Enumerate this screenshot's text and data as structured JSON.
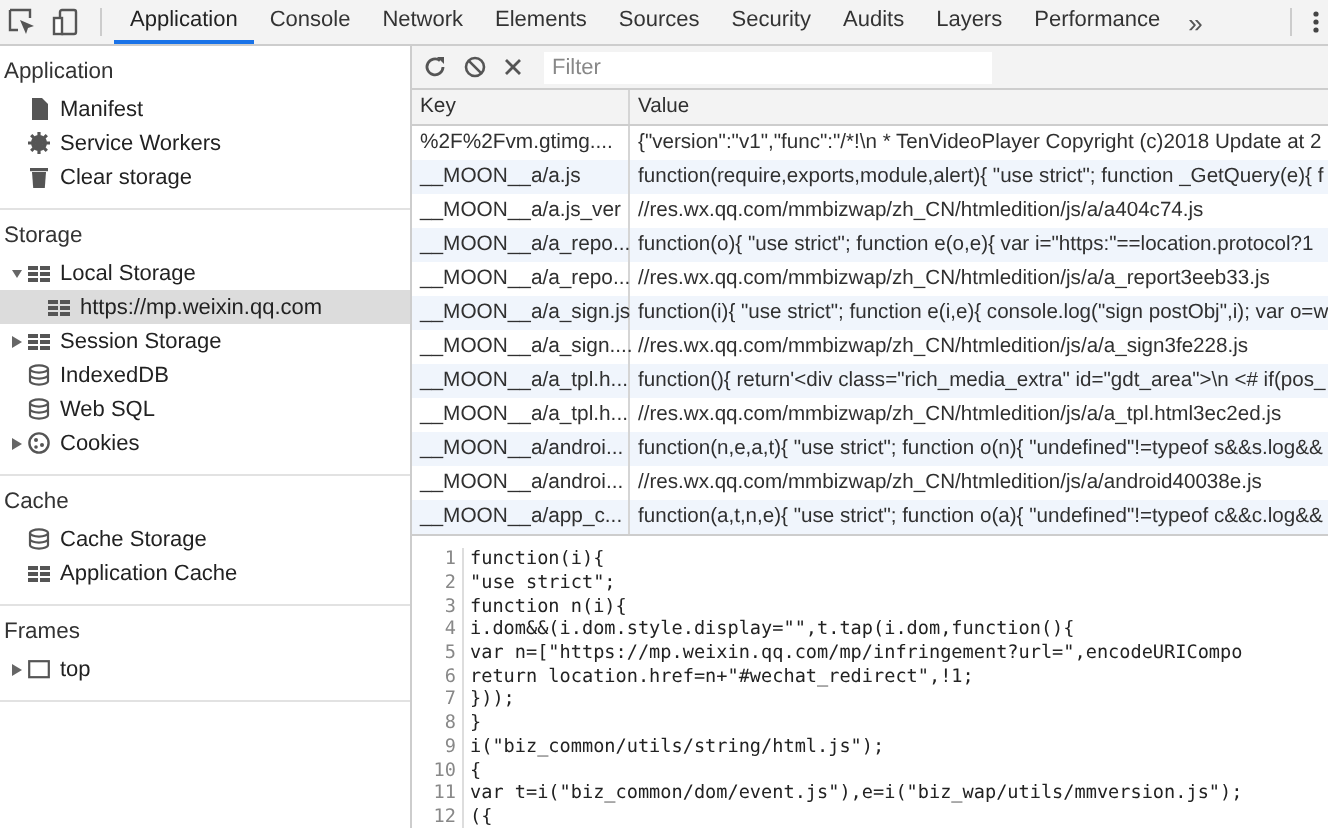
{
  "tabs": [
    {
      "label": "Application",
      "selected": true
    },
    {
      "label": "Console",
      "selected": false
    },
    {
      "label": "Network",
      "selected": false
    },
    {
      "label": "Elements",
      "selected": false
    },
    {
      "label": "Sources",
      "selected": false
    },
    {
      "label": "Security",
      "selected": false
    },
    {
      "label": "Audits",
      "selected": false
    },
    {
      "label": "Layers",
      "selected": false
    },
    {
      "label": "Performance",
      "selected": false
    }
  ],
  "tabs_overflow": "»",
  "sidebar": {
    "sections": [
      {
        "title": "Application",
        "items": [
          {
            "label": "Manifest",
            "kind": "file",
            "selected": false
          },
          {
            "label": "Service Workers",
            "kind": "gear",
            "selected": false
          },
          {
            "label": "Clear storage",
            "kind": "trash",
            "selected": false
          }
        ]
      },
      {
        "title": "Storage",
        "items": [
          {
            "label": "Local Storage",
            "kind": "grid",
            "selected": false,
            "expanded": true,
            "children": [
              {
                "label": "https://mp.weixin.qq.com",
                "kind": "grid",
                "selected": true
              }
            ]
          },
          {
            "label": "Session Storage",
            "kind": "grid",
            "selected": false,
            "expanded": false
          },
          {
            "label": "IndexedDB",
            "kind": "database",
            "selected": false
          },
          {
            "label": "Web SQL",
            "kind": "database",
            "selected": false
          },
          {
            "label": "Cookies",
            "kind": "cookie",
            "selected": false,
            "expanded": false
          }
        ]
      },
      {
        "title": "Cache",
        "items": [
          {
            "label": "Cache Storage",
            "kind": "database",
            "selected": false
          },
          {
            "label": "Application Cache",
            "kind": "grid",
            "selected": false
          }
        ]
      },
      {
        "title": "Frames",
        "items": [
          {
            "label": "top",
            "kind": "frame",
            "selected": false,
            "expanded": false
          }
        ]
      }
    ]
  },
  "filter": {
    "placeholder": "Filter"
  },
  "table": {
    "columns": [
      "Key",
      "Value"
    ],
    "rows": [
      {
        "key": "%2F%2Fvm.gtimg....",
        "value": "{\"version\":\"v1\",\"func\":\"/*!\\n * TenVideoPlayer Copyright (c)2018 Update at 2"
      },
      {
        "key": "__MOON__a/a.js",
        "value": "function(require,exports,module,alert){ \"use strict\"; function _GetQuery(e){ f"
      },
      {
        "key": "__MOON__a/a.js_ver",
        "value": "//res.wx.qq.com/mmbizwap/zh_CN/htmledition/js/a/a404c74.js"
      },
      {
        "key": "__MOON__a/a_repo...",
        "value": "function(o){ \"use strict\"; function e(o,e){ var i=\"https:\"==location.protocol?1"
      },
      {
        "key": "__MOON__a/a_repo...",
        "value": "//res.wx.qq.com/mmbizwap/zh_CN/htmledition/js/a/a_report3eeb33.js"
      },
      {
        "key": "__MOON__a/a_sign.js",
        "value": "function(i){ \"use strict\"; function e(i,e){ console.log(\"sign postObj\",i); var o=w"
      },
      {
        "key": "__MOON__a/a_sign....",
        "value": "//res.wx.qq.com/mmbizwap/zh_CN/htmledition/js/a/a_sign3fe228.js"
      },
      {
        "key": "__MOON__a/a_tpl.h...",
        "value": "function(){ return'<div class=\"rich_media_extra\" id=\"gdt_area\">\\n <# if(pos_"
      },
      {
        "key": "__MOON__a/a_tpl.h...",
        "value": "//res.wx.qq.com/mmbizwap/zh_CN/htmledition/js/a/a_tpl.html3ec2ed.js"
      },
      {
        "key": "__MOON__a/androi...",
        "value": "function(n,e,a,t){ \"use strict\"; function o(n){ \"undefined\"!=typeof s&&s.log&&"
      },
      {
        "key": "__MOON__a/androi...",
        "value": "//res.wx.qq.com/mmbizwap/zh_CN/htmledition/js/a/android40038e.js"
      },
      {
        "key": "__MOON__a/app_c...",
        "value": "function(a,t,n,e){ \"use strict\"; function o(a){ \"undefined\"!=typeof c&&c.log&&"
      }
    ]
  },
  "code": [
    {
      "number": "1",
      "text": "function(i){"
    },
    {
      "number": "2",
      "text": "\"use strict\";"
    },
    {
      "number": "3",
      "text": "function n(i){"
    },
    {
      "number": "4",
      "text": "i.dom&&(i.dom.style.display=\"\",t.tap(i.dom,function(){"
    },
    {
      "number": "5",
      "text": "var n=[\"https://mp.weixin.qq.com/mp/infringement?url=\",encodeURICompo"
    },
    {
      "number": "6",
      "text": "return location.href=n+\"#wechat_redirect\",!1;"
    },
    {
      "number": "7",
      "text": "}));"
    },
    {
      "number": "8",
      "text": "}"
    },
    {
      "number": "9",
      "text": "i(\"biz_common/utils/string/html.js\");"
    },
    {
      "number": "10",
      "text": "{"
    },
    {
      "number": "11",
      "text": "var t=i(\"biz_common/dom/event.js\"),e=i(\"biz_wap/utils/mmversion.js\");"
    },
    {
      "number": "12",
      "text": "({"
    }
  ]
}
